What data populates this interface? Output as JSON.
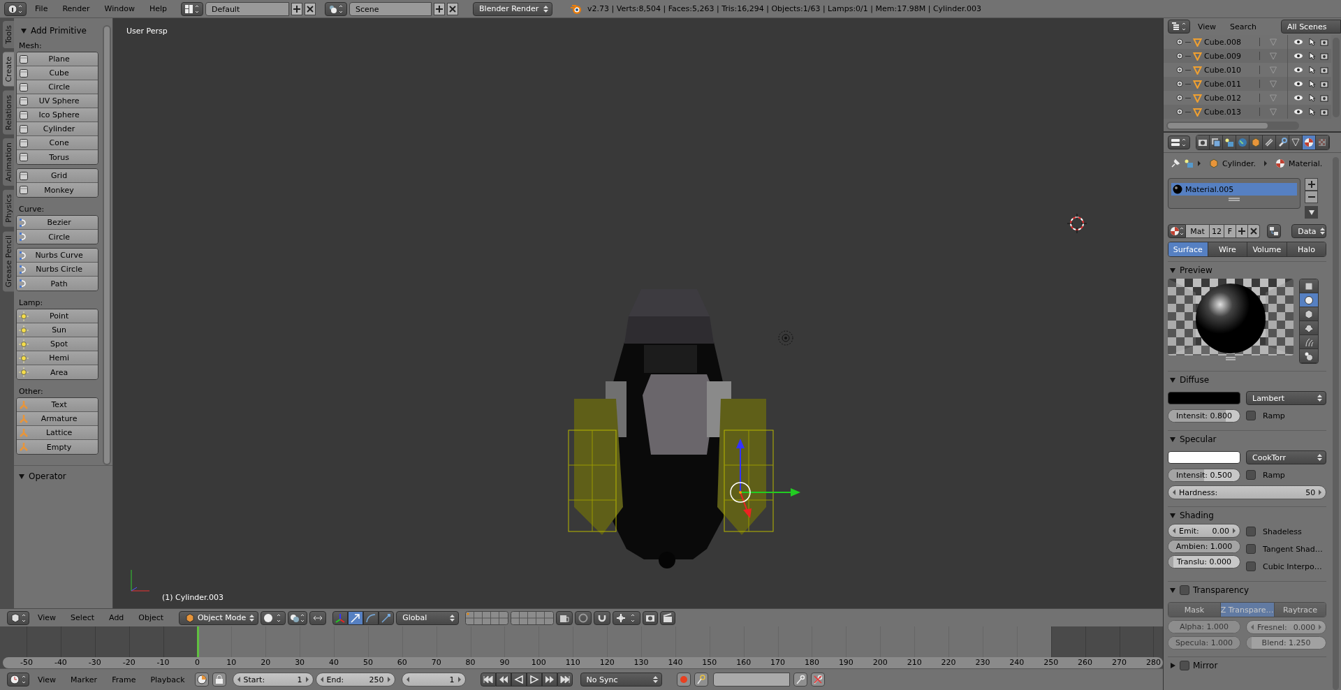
{
  "top_bar": {
    "menus": [
      "File",
      "Render",
      "Window",
      "Help"
    ],
    "layout": "Default",
    "scene": "Scene",
    "engine": "Blender Render",
    "stats": "v2.73 | Verts:8,504 | Faces:5,263 | Tris:16,294 | Objects:1/63 | Lamps:0/1 | Mem:17.98M | Cylinder.003"
  },
  "tool_tabs": [
    {
      "label": "Tools",
      "selected": false
    },
    {
      "label": "Create",
      "selected": true
    },
    {
      "label": "Relations",
      "selected": false
    },
    {
      "label": "Animation",
      "selected": false
    },
    {
      "label": "Physics",
      "selected": false
    },
    {
      "label": "Grease Pencil",
      "selected": false
    }
  ],
  "tool_panel": {
    "title": "Add Primitive",
    "expanded": true,
    "sections": [
      {
        "label": "Mesh:",
        "kind": "mesh",
        "blocks": [
          [
            "Plane",
            "Cube",
            "Circle",
            "UV Sphere",
            "Ico Sphere",
            "Cylinder",
            "Cone",
            "Torus"
          ],
          [
            "Grid",
            "Monkey"
          ]
        ]
      },
      {
        "label": "Curve:",
        "kind": "curve",
        "blocks": [
          [
            "Bezier",
            "Circle"
          ],
          [
            "Nurbs Curve",
            "Nurbs Circle",
            "Path"
          ]
        ]
      },
      {
        "label": "Lamp:",
        "kind": "lamp",
        "blocks": [
          [
            "Point",
            "Sun",
            "Spot",
            "Hemi",
            "Area"
          ]
        ]
      },
      {
        "label": "Other:",
        "kind": "other",
        "blocks": [
          [
            "Text",
            "Armature",
            "Lattice",
            "Empty"
          ]
        ]
      }
    ]
  },
  "operator_panel": {
    "title": "Operator",
    "expanded": true
  },
  "viewport": {
    "view_name": "User Persp",
    "object_label": "(1) Cylinder.003"
  },
  "view_header": {
    "menus": [
      "View",
      "Select",
      "Add",
      "Object"
    ],
    "mode": "Object Mode",
    "orientation": "Global"
  },
  "timeline": {
    "ticks": [
      {
        "label": "-50",
        "in_range": false,
        "current": false
      },
      {
        "label": "-40",
        "in_range": false,
        "current": false
      },
      {
        "label": "-30",
        "in_range": false,
        "current": false
      },
      {
        "label": "-20",
        "in_range": false,
        "current": false
      },
      {
        "label": "-10",
        "in_range": false,
        "current": false
      },
      {
        "label": "0",
        "in_range": true,
        "current": true
      },
      {
        "label": "10",
        "in_range": true,
        "current": false
      },
      {
        "label": "20",
        "in_range": true,
        "current": false
      },
      {
        "label": "30",
        "in_range": true,
        "current": false
      },
      {
        "label": "40",
        "in_range": true,
        "current": false
      },
      {
        "label": "50",
        "in_range": true,
        "current": false
      },
      {
        "label": "60",
        "in_range": true,
        "current": false
      },
      {
        "label": "70",
        "in_range": true,
        "current": false
      },
      {
        "label": "80",
        "in_range": true,
        "current": false
      },
      {
        "label": "90",
        "in_range": true,
        "current": false
      },
      {
        "label": "100",
        "in_range": true,
        "current": false
      },
      {
        "label": "110",
        "in_range": true,
        "current": false
      },
      {
        "label": "120",
        "in_range": true,
        "current": false
      },
      {
        "label": "130",
        "in_range": true,
        "current": false
      },
      {
        "label": "140",
        "in_range": true,
        "current": false
      },
      {
        "label": "150",
        "in_range": true,
        "current": false
      },
      {
        "label": "160",
        "in_range": true,
        "current": false
      },
      {
        "label": "170",
        "in_range": true,
        "current": false
      },
      {
        "label": "180",
        "in_range": true,
        "current": false
      },
      {
        "label": "190",
        "in_range": true,
        "current": false
      },
      {
        "label": "200",
        "in_range": true,
        "current": false
      },
      {
        "label": "210",
        "in_range": true,
        "current": false
      },
      {
        "label": "220",
        "in_range": true,
        "current": false
      },
      {
        "label": "230",
        "in_range": true,
        "current": false
      },
      {
        "label": "240",
        "in_range": true,
        "current": false
      },
      {
        "label": "250",
        "in_range": false,
        "current": false
      },
      {
        "label": "260",
        "in_range": false,
        "current": false
      },
      {
        "label": "270",
        "in_range": false,
        "current": false
      },
      {
        "label": "280",
        "in_range": false,
        "current": false
      }
    ]
  },
  "timeline_header": {
    "menus": [
      "View",
      "Marker",
      "Frame",
      "Playback"
    ],
    "start_label": "Start:",
    "start": "1",
    "end_label": "End:",
    "end": "250",
    "frame": "1",
    "sync": "No Sync"
  },
  "outliner": {
    "menus": [
      "View",
      "Search"
    ],
    "scope": "All Scenes",
    "rows": [
      {
        "name": "Cube.008"
      },
      {
        "name": "Cube.009"
      },
      {
        "name": "Cube.010"
      },
      {
        "name": "Cube.011"
      },
      {
        "name": "Cube.012"
      },
      {
        "name": "Cube.013"
      }
    ]
  },
  "properties": {
    "tabs": [
      {
        "kind": "render",
        "selected": false
      },
      {
        "kind": "layers",
        "selected": false
      },
      {
        "kind": "scene",
        "selected": false
      },
      {
        "kind": "world",
        "selected": false
      },
      {
        "kind": "object",
        "selected": false
      },
      {
        "kind": "constraints",
        "selected": false
      },
      {
        "kind": "modifiers",
        "selected": false
      },
      {
        "kind": "data",
        "selected": false
      },
      {
        "kind": "material",
        "selected": true
      },
      {
        "kind": "texture",
        "selected": false
      }
    ],
    "breadcrumb": [
      "Cylinder.",
      "Material."
    ],
    "slots": [
      {
        "name": "Material.005",
        "selected": true
      }
    ],
    "datablock": {
      "name": "Mat",
      "users": "12",
      "fake": "F",
      "link": "Data"
    },
    "shading_types": [
      {
        "label": "Surface",
        "selected": true
      },
      {
        "label": "Wire",
        "selected": false
      },
      {
        "label": "Volume",
        "selected": false
      },
      {
        "label": "Halo",
        "selected": false
      }
    ],
    "preview": {
      "title": "Preview",
      "expanded": true,
      "shapes": [
        {
          "kind": "flat",
          "selected": false
        },
        {
          "kind": "sphere",
          "selected": true
        },
        {
          "kind": "cube",
          "selected": false
        },
        {
          "kind": "monkey",
          "selected": false
        },
        {
          "kind": "hair",
          "selected": false
        },
        {
          "kind": "sky",
          "selected": false
        }
      ]
    },
    "diffuse": {
      "title": "Diffuse",
      "expanded": true,
      "color": "#000000",
      "shader": "Lambert",
      "intensity": {
        "label": "Intensit:",
        "value": "0.800",
        "level": 0.8
      },
      "ramp": {
        "label": "Ramp",
        "checked": false
      }
    },
    "specular": {
      "title": "Specular",
      "expanded": true,
      "color": "#ffffff",
      "shader": "CookTorr",
      "intensity": {
        "label": "Intensit:",
        "value": "0.500",
        "level": 0.5
      },
      "ramp": {
        "label": "Ramp",
        "checked": false
      },
      "hardness": {
        "label": "Hardness:",
        "value": "50"
      }
    },
    "shading": {
      "title": "Shading",
      "expanded": true,
      "fields": [
        {
          "label": "Emit:",
          "value": "0.00",
          "kind": "arrows"
        },
        {
          "label": "Ambien:",
          "value": "1.000",
          "kind": "slider",
          "level": 1
        },
        {
          "label": "Translu:",
          "value": "0.000",
          "kind": "slider",
          "level": 0
        }
      ],
      "options": [
        {
          "label": "Shadeless",
          "checked": false
        },
        {
          "label": "Tangent Shad…",
          "checked": false
        },
        {
          "label": "Cubic Interpo…",
          "checked": false
        }
      ]
    },
    "transparency": {
      "title": "Transparency",
      "expanded": true,
      "enabled": false,
      "methods": [
        {
          "label": "Mask",
          "selected": false
        },
        {
          "label": "Z Transpare…",
          "selected": true
        },
        {
          "label": "Raytrace",
          "selected": false
        }
      ],
      "fields": [
        {
          "label": "Alpha:",
          "value": "1.000",
          "kind": "slider",
          "level": 1
        },
        {
          "label": "Fresnel:",
          "value": "0.000",
          "kind": "arrows"
        },
        {
          "label": "Specula:",
          "value": "1.000",
          "kind": "slider",
          "level": 1
        },
        {
          "label": "Blend:",
          "value": "1.250",
          "kind": "slider",
          "level": 0.06
        }
      ]
    },
    "mirror": {
      "title": "Mirror",
      "expanded": false,
      "enabled": false
    }
  }
}
